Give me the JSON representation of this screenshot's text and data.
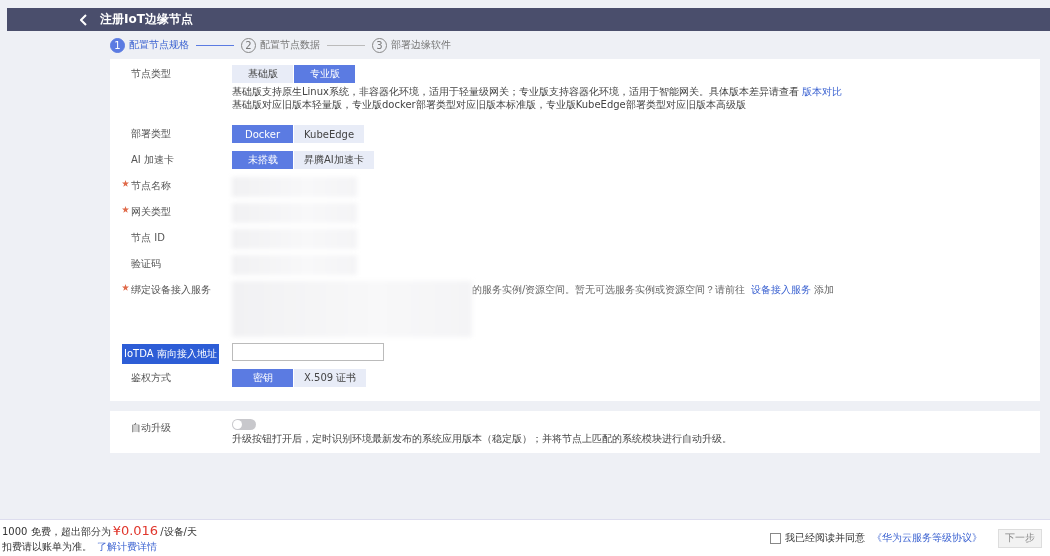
{
  "header": {
    "title": "注册IoT边缘节点"
  },
  "steps": [
    {
      "number": "1",
      "label": "配置节点规格",
      "selected": true
    },
    {
      "number": "2",
      "label": "配置节点数据",
      "selected": false
    },
    {
      "number": "3",
      "label": "部署边缘软件",
      "selected": false
    }
  ],
  "form": [
    {
      "kind": "segmented",
      "label": "节点类型",
      "required": false,
      "options": [
        {
          "label": "基础版",
          "selected": false
        },
        {
          "label": "专业版",
          "selected": true
        }
      ],
      "notes": [
        {
          "text": "基础版支持原生Linux系统，非容器化环境，适用于轻量级网关；专业版支持容器化环境，适用于智能网关。具体版本差异请查看",
          "link": "版本对比"
        },
        {
          "text": "基础版对应旧版本轻量版，专业版docker部署类型对应旧版本标准版，专业版KubeEdge部署类型对应旧版本高级版"
        }
      ]
    },
    {
      "kind": "segmented",
      "label": "部署类型",
      "required": false,
      "options": [
        {
          "label": "Docker",
          "selected": true
        },
        {
          "label": "KubeEdge",
          "selected": false
        }
      ]
    },
    {
      "kind": "segmented",
      "label": "AI 加速卡",
      "required": false,
      "options": [
        {
          "label": "未搭载",
          "selected": true
        },
        {
          "label": "昇腾AI加速卡",
          "selected": false
        }
      ]
    },
    {
      "kind": "blurred",
      "label": "节点名称",
      "required": true
    },
    {
      "kind": "blurred",
      "label": "网关类型",
      "required": true
    },
    {
      "kind": "blurred",
      "label": "节点 ID",
      "required": false
    },
    {
      "kind": "blurred",
      "label": "验证码",
      "required": false
    },
    {
      "kind": "service",
      "label": "绑定设备接入服务",
      "required": true,
      "hint": "的服务实例/资源空间。暂无可选服务实例或资源空间？请前往",
      "link": "设备接入服务",
      "after": "添加"
    },
    {
      "kind": "input",
      "label": "IoTDA 南向接入地址",
      "required": false,
      "highlighted": true
    },
    {
      "kind": "segmented",
      "label": "鉴权方式",
      "required": false,
      "options": [
        {
          "label": "密钥",
          "selected": true
        },
        {
          "label": "X.509 证书",
          "selected": false
        }
      ]
    }
  ],
  "upgrade": {
    "label": "自动升级",
    "on": false,
    "note": "升级按钮打开后，定时识别环境最新发布的系统应用版本（稳定版）；并将节点上匹配的系统模块进行自动升级。"
  },
  "footer": {
    "price_prefix": "1000 免费，超出部分为",
    "price": "¥0.016",
    "price_suffix": "/设备/天",
    "billing_note": "扣费请以账单为准。",
    "billing_link": "了解计费详情",
    "agree_checked": false,
    "agree_text": "我已经阅读并同意",
    "agreement_link": "《华为云服务等级协议》",
    "next_button": "下一步",
    "next_disabled": true
  }
}
